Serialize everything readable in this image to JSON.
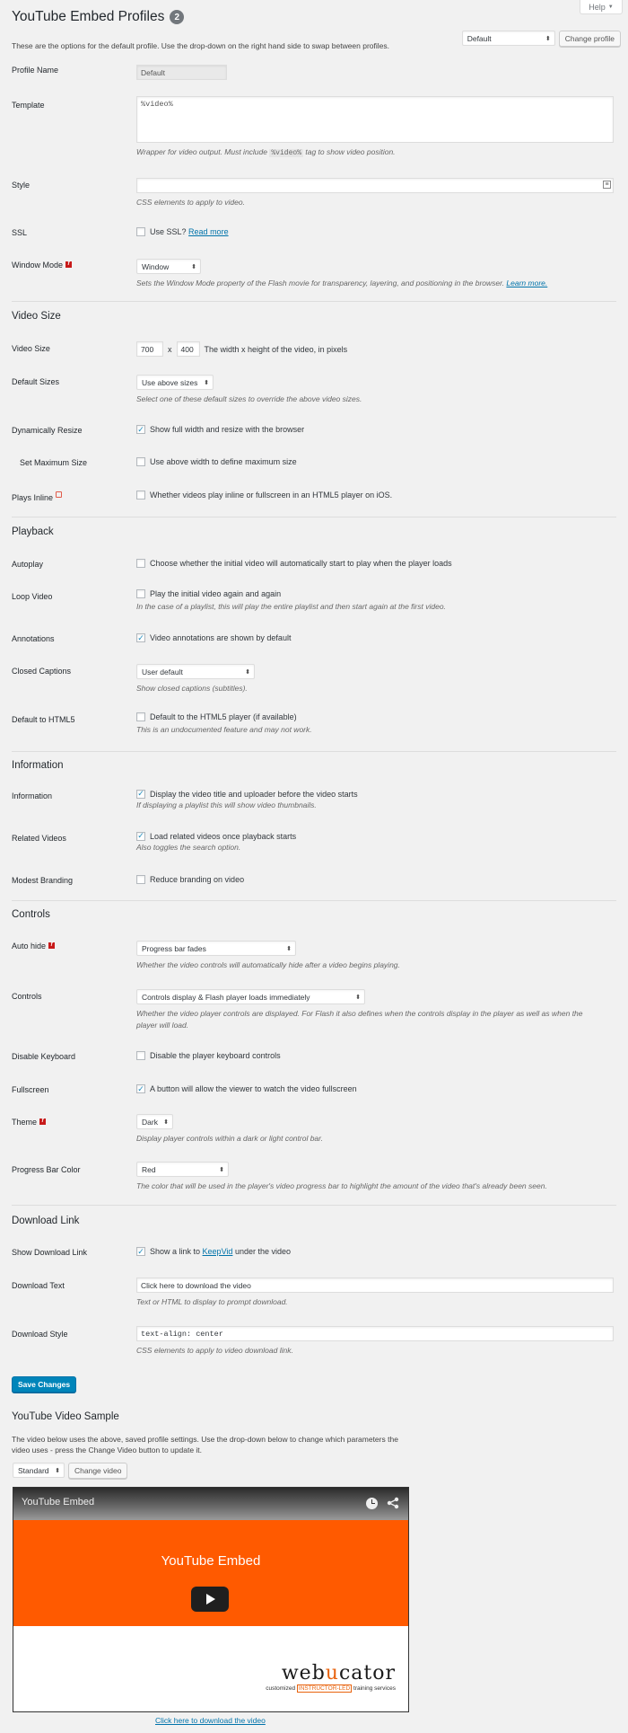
{
  "help_tab": {
    "label": "Help"
  },
  "header": {
    "title": "YouTube Embed Profiles",
    "count": "2",
    "intro": "These are the options for the default profile. Use the drop-down on the right hand side to swap between profiles.",
    "profile_select": "Default",
    "change_profile_label": "Change profile"
  },
  "general": {
    "profile_name": {
      "label": "Profile Name",
      "value": "Default"
    },
    "template": {
      "label": "Template",
      "value": "%video%",
      "desc_before": "Wrapper for video output. Must include",
      "desc_code": "%video%",
      "desc_after": "tag to show video position."
    },
    "style": {
      "label": "Style",
      "value": "",
      "desc": "CSS elements to apply to video."
    },
    "ssl": {
      "label": "SSL",
      "text": "Use SSL?",
      "link": "Read more",
      "checked": false
    },
    "window_mode": {
      "label": "Window Mode",
      "value": "Window",
      "desc": "Sets the Window Mode property of the Flash movie for transparency, layering, and positioning in the browser.",
      "link": "Learn more."
    }
  },
  "video_size": {
    "title": "Video Size",
    "size": {
      "label": "Video Size",
      "width": "700",
      "x": "x",
      "height": "400",
      "text": "The width x height of the video, in pixels"
    },
    "default_sizes": {
      "label": "Default Sizes",
      "value": "Use above sizes",
      "desc": "Select one of these default sizes to override the above video sizes."
    },
    "dynamic": {
      "label": "Dynamically Resize",
      "text": "Show full width and resize with the browser",
      "checked": true
    },
    "max_size": {
      "label": "Set Maximum Size",
      "text": "Use above width to define maximum size",
      "checked": false
    },
    "plays_inline": {
      "label": "Plays Inline",
      "text": "Whether videos play inline or fullscreen in an HTML5 player on iOS.",
      "checked": false
    }
  },
  "playback": {
    "title": "Playback",
    "autoplay": {
      "label": "Autoplay",
      "text": "Choose whether the initial video will automatically start to play when the player loads",
      "checked": false
    },
    "loop": {
      "label": "Loop Video",
      "text": "Play the initial video again and again",
      "desc": "In the case of a playlist, this will play the entire playlist and then start again at the first video.",
      "checked": false
    },
    "annotations": {
      "label": "Annotations",
      "text": "Video annotations are shown by default",
      "checked": true
    },
    "captions": {
      "label": "Closed Captions",
      "value": "User default",
      "desc": "Show closed captions (subtitles)."
    },
    "html5": {
      "label": "Default to HTML5",
      "text": "Default to the HTML5 player (if available)",
      "desc": "This is an undocumented feature and may not work.",
      "checked": false
    }
  },
  "information": {
    "title": "Information",
    "info": {
      "label": "Information",
      "text": "Display the video title and uploader before the video starts",
      "desc": "If displaying a playlist this will show video thumbnails.",
      "checked": true
    },
    "related": {
      "label": "Related Videos",
      "text": "Load related videos once playback starts",
      "desc": "Also toggles the search option.",
      "checked": true
    },
    "branding": {
      "label": "Modest Branding",
      "text": "Reduce branding on video",
      "checked": false
    }
  },
  "controls": {
    "title": "Controls",
    "autohide": {
      "label": "Auto hide",
      "value": "Progress bar fades",
      "desc": "Whether the video controls will automatically hide after a video begins playing."
    },
    "controls": {
      "label": "Controls",
      "value": "Controls display & Flash player loads immediately",
      "desc": "Whether the video player controls are displayed. For Flash it also defines when the controls display in the player as well as when the player will load."
    },
    "keyboard": {
      "label": "Disable Keyboard",
      "text": "Disable the player keyboard controls",
      "checked": false
    },
    "fullscreen": {
      "label": "Fullscreen",
      "text": "A button will allow the viewer to watch the video fullscreen",
      "checked": true
    },
    "theme": {
      "label": "Theme",
      "value": "Dark",
      "desc": "Display player controls within a dark or light control bar."
    },
    "progress_color": {
      "label": "Progress Bar Color",
      "value": "Red",
      "desc": "The color that will be used in the player's video progress bar to highlight the amount of the video that's already been seen."
    }
  },
  "download": {
    "title": "Download Link",
    "show": {
      "label": "Show Download Link",
      "text_before": "Show a link to",
      "link": "KeepVid",
      "text_after": "under the video",
      "checked": true
    },
    "text": {
      "label": "Download Text",
      "value": "Click here to download the video",
      "desc": "Text or HTML to display to prompt download."
    },
    "style": {
      "label": "Download Style",
      "value": "text-align: center",
      "desc": "CSS elements to apply to video download link."
    }
  },
  "save_label": "Save Changes",
  "sample": {
    "title": "YouTube Video Sample",
    "desc": "The video below uses the above, saved profile settings. Use the drop-down below to change which parameters the video uses - press the Change Video button to update it.",
    "select": "Standard",
    "change_label": "Change video",
    "player_title": "YouTube Embed",
    "video_heading": "YouTube Embed",
    "logo_web": "web",
    "logo_u": "u",
    "logo_rest": "cator",
    "logo_tag_left": "customized",
    "logo_tag_mid": "INSTRUCTOR-LED",
    "logo_tag_right": "training services",
    "download_link": "Click here to download the video"
  },
  "colors": {
    "accent": "#0085ba",
    "video_orange": "#ff5a00",
    "link": "#0073aa"
  },
  "icons": [
    "flash-icon",
    "ios-icon",
    "clock-icon",
    "share-icon",
    "play-icon",
    "expand-icon"
  ]
}
